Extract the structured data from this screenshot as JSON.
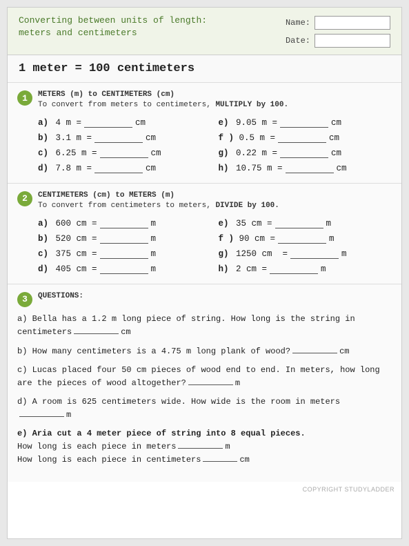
{
  "header": {
    "title_line1": "Converting between units of length:",
    "title_line2": "meters and centimeters",
    "name_label": "Name:",
    "date_label": "Date:"
  },
  "rule": {
    "text": "1 meter = 100 centimeters"
  },
  "section1": {
    "number": "1",
    "title": "METERS (m) to CENTIMETERS (cm)",
    "subtitle_plain": "To convert from meters to centimeters, ",
    "subtitle_bold": "MULTIPLY by 100.",
    "problems": [
      {
        "letter": "a)",
        "expression": "4 m =",
        "unit": "cm"
      },
      {
        "letter": "e)",
        "expression": "9.05 m =",
        "unit": "cm"
      },
      {
        "letter": "b)",
        "expression": "3.1 m =",
        "unit": "cm"
      },
      {
        "letter": "f )",
        "expression": "0.5 m =",
        "unit": "cm"
      },
      {
        "letter": "c)",
        "expression": "6.25 m =",
        "unit": "cm"
      },
      {
        "letter": "g)",
        "expression": "0.22 m =",
        "unit": "cm"
      },
      {
        "letter": "d)",
        "expression": "7.8 m =",
        "unit": "cm"
      },
      {
        "letter": "h)",
        "expression": "10.75 m =",
        "unit": "cm"
      }
    ]
  },
  "section2": {
    "number": "2",
    "title": "CENTIMETERS (cm) to METERS (m)",
    "subtitle_plain": "To convert from centimeters to meters, ",
    "subtitle_bold": "DIVIDE by 100.",
    "problems": [
      {
        "letter": "a)",
        "expression": "600 cm =",
        "unit": "m"
      },
      {
        "letter": "e)",
        "expression": "35 cm =",
        "unit": "m"
      },
      {
        "letter": "b)",
        "expression": "520 cm =",
        "unit": "m"
      },
      {
        "letter": "f )",
        "expression": "90 cm =",
        "unit": "m"
      },
      {
        "letter": "c)",
        "expression": "375 cm =",
        "unit": "m"
      },
      {
        "letter": "g)",
        "expression": "1250 cm  =",
        "unit": "m"
      },
      {
        "letter": "d)",
        "expression": "405 cm =",
        "unit": "m"
      },
      {
        "letter": "h)",
        "expression": "2 cm =",
        "unit": "m"
      }
    ]
  },
  "section3": {
    "number": "3",
    "title": "QUESTIONS:",
    "questions": [
      {
        "id": "qa",
        "text_parts": [
          "a) Bella has a 1.2 m long piece of string. How long is the string in centimeters",
          "cm"
        ]
      },
      {
        "id": "qb",
        "text_parts": [
          "b) How many centimeters is a 4.75 m long plank of wood?",
          "cm"
        ]
      },
      {
        "id": "qc",
        "text_parts": [
          "c) Lucas placed four 50 cm pieces of wood end to end. In meters, how long are the pieces of wood altogether?",
          "m"
        ]
      },
      {
        "id": "qd",
        "text_parts": [
          "d) A room is 625 centimeters wide. How wide is the room in meters",
          "m"
        ]
      },
      {
        "id": "qe",
        "label_bold": "e) Aria cut a 4 meter piece of string into 8 equal pieces.",
        "line1": "How long is each piece in meters",
        "unit1": "m",
        "line2": "How long is each piece in centimeters",
        "unit2": "cm"
      }
    ]
  },
  "copyright": "COPYRIGHT STUDYLADDER"
}
